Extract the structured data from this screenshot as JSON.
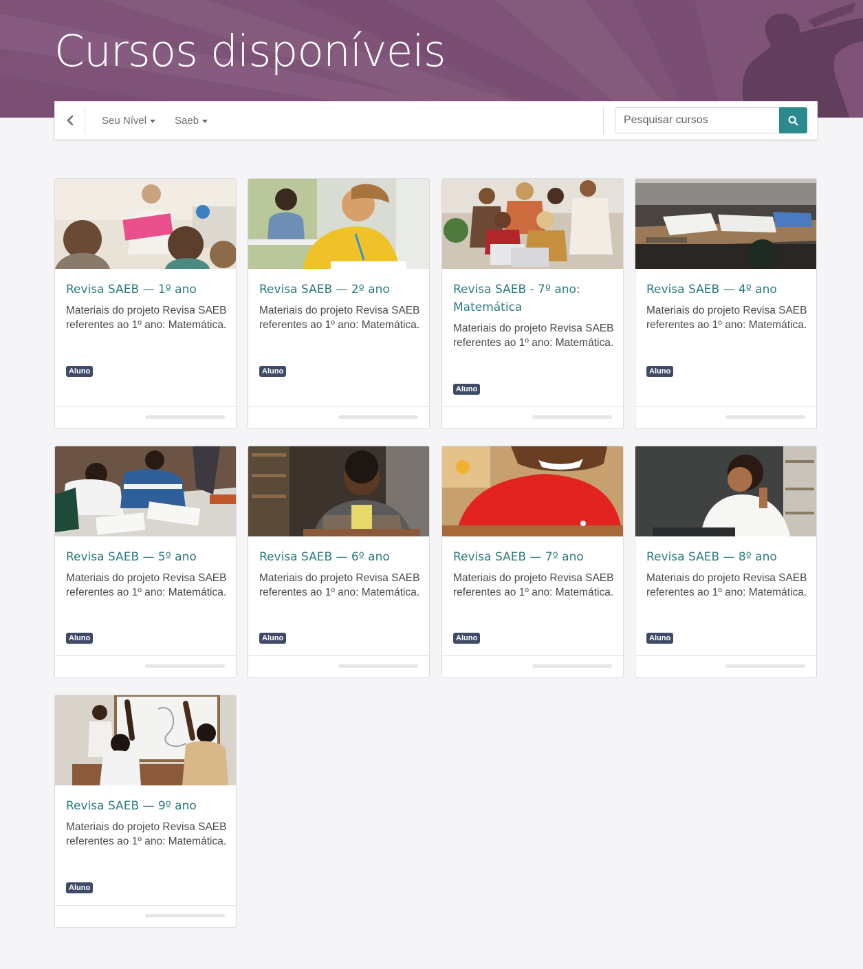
{
  "header": {
    "title": "Cursos disponíveis"
  },
  "toolbar": {
    "back_icon": "chevron-left-icon",
    "filters": [
      {
        "label": "Seu Nível"
      },
      {
        "label": "Saeb"
      }
    ],
    "search": {
      "placeholder": "Pesquisar cursos",
      "icon": "search-icon"
    }
  },
  "colors": {
    "banner": "#7e5377",
    "accent": "#2b8a8e",
    "title_link": "#2a7a7e",
    "badge": "#3e4a67"
  },
  "courses": [
    {
      "title": "Revisa SAEB — 1º ano",
      "description": "Materiais do projeto Revisa SAEB referentes ao 1º ano: Matemática.",
      "badge": "Aluno"
    },
    {
      "title": "Revisa SAEB — 2º ano",
      "description": "Materiais do projeto Revisa SAEB referentes ao 1º ano: Matemática.",
      "badge": "Aluno"
    },
    {
      "title": "Revisa SAEB - 7º ano: Matemática",
      "description": "Materiais do projeto Revisa SAEB referentes ao 1º ano: Matemática.",
      "badge": "Aluno"
    },
    {
      "title": "Revisa SAEB — 4º ano",
      "description": "Materiais do projeto Revisa SAEB referentes ao 1º ano: Matemática.",
      "badge": "Aluno"
    },
    {
      "title": "Revisa SAEB — 5º ano",
      "description": "Materiais do projeto Revisa SAEB referentes ao 1º ano: Matemática.",
      "badge": "Aluno"
    },
    {
      "title": "Revisa SAEB — 6º ano",
      "description": "Materiais do projeto Revisa SAEB referentes ao 1º ano: Matemática.",
      "badge": "Aluno"
    },
    {
      "title": "Revisa SAEB — 7º ano",
      "description": "Materiais do projeto Revisa SAEB referentes ao 1º ano: Matemática.",
      "badge": "Aluno"
    },
    {
      "title": "Revisa SAEB — 8º ano",
      "description": "Materiais do projeto Revisa SAEB referentes ao 1º ano: Matemática.",
      "badge": "Aluno"
    },
    {
      "title": "Revisa SAEB — 9º ano",
      "description": "Materiais do projeto Revisa SAEB referentes ao 1º ano: Matemática.",
      "badge": "Aluno"
    }
  ]
}
